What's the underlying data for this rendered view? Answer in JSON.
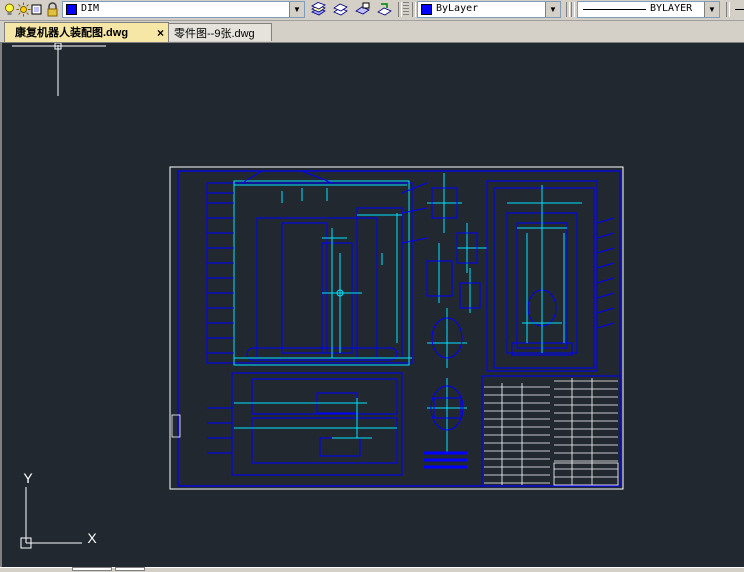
{
  "toolbar": {
    "layer_name": "DIM",
    "color_value": "ByLayer",
    "linetype_value": "BYLAYER",
    "icons": [
      "lightbulb-icon",
      "sun-icon",
      "lock-icon",
      "layer-color-swatch",
      "layer-dropdown",
      "layer-prev-icon",
      "layer-states-icon",
      "make-current-icon",
      "match-layer-icon"
    ]
  },
  "tabs": [
    {
      "label": "康复机器人装配图.dwg",
      "active": true
    },
    {
      "label": "零件图--9张.dwg",
      "active": false
    }
  ],
  "canvas": {
    "background": "#212830",
    "drawing_color": "#0000ff",
    "highlight_color": "#00e5ff",
    "ucs_x_label": "X",
    "ucs_y_label": "Y"
  }
}
